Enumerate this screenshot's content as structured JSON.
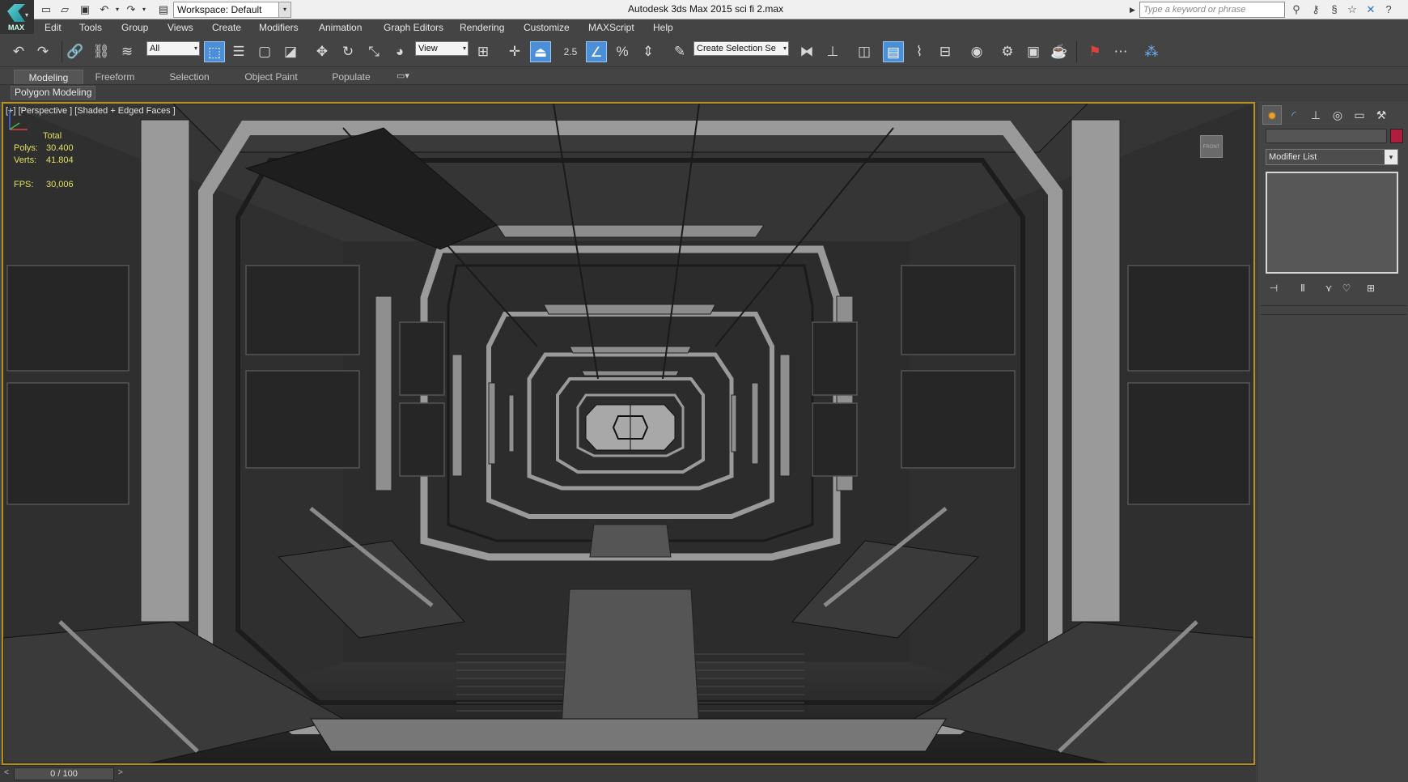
{
  "titlebar": {
    "workspace": "Workspace: Default",
    "title": "Autodesk 3ds Max  2015     sci fi 2.max",
    "search_placeholder": "Type a keyword or phrase",
    "logo_text": "MAX"
  },
  "menu": [
    "Edit",
    "Tools",
    "Group",
    "Views",
    "Create",
    "Modifiers",
    "Animation",
    "Graph Editors",
    "Rendering",
    "Customize",
    "MAXScript",
    "Help"
  ],
  "toolbar": {
    "selection_filter": "All",
    "ref_coord": "View",
    "snap_value": "2.5",
    "named_selection_placeholder": "Create Selection Se"
  },
  "ribbon": {
    "tabs": [
      "Modeling",
      "Freeform",
      "Selection",
      "Object Paint",
      "Populate"
    ],
    "active_tab": "Modeling",
    "panel_label": "Polygon Modeling"
  },
  "viewport": {
    "label": "[+] [Perspective ] [Shaded + Edged Faces ]",
    "stats_header": "Total",
    "polys_label": "Polys:",
    "polys_value": "30.400",
    "verts_label": "Verts:",
    "verts_value": "41.804",
    "fps_label": "FPS:",
    "fps_value": "30,006",
    "viewcube_label": "FRONT",
    "border_color": "#b38f1b",
    "stats_color": "#e0e060"
  },
  "timeline": {
    "frame": "0 / 100"
  },
  "command_panel": {
    "modifier_list": "Modifier List",
    "object_color": "#b01e3c"
  }
}
